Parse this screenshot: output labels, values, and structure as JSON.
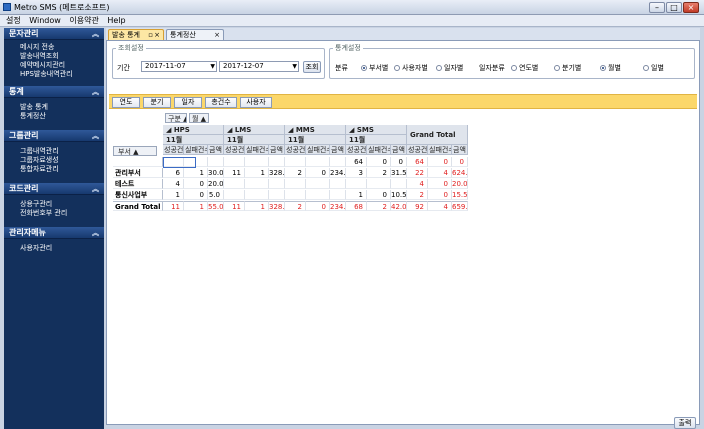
{
  "window": {
    "title": "Metro SMS (메트로소프트)"
  },
  "menu": [
    "설정",
    "Window",
    "이용약관",
    "Help"
  ],
  "sidebar": {
    "sections": [
      {
        "title": "문자관리",
        "items": [
          "메시지 전송",
          "발송내역조회",
          "예약메시지관리",
          "HPS발송내역관리"
        ]
      },
      {
        "title": "통계",
        "items": [
          "발송 통계",
          "통계정산"
        ]
      },
      {
        "title": "그룹관리",
        "items": [
          "그룹내역관리",
          "그룹자료생성",
          "통합자료관리"
        ]
      },
      {
        "title": "코드관리",
        "items": [
          "상용구관리",
          "전화번호부 관리"
        ]
      },
      {
        "title": "관리자메뉴",
        "items": [
          "사용자관리"
        ]
      }
    ]
  },
  "tabs": [
    {
      "label": "발송 통계",
      "pin": "▫",
      "close": "×"
    },
    {
      "label": "통계정산",
      "close": "×"
    }
  ],
  "filter": {
    "legend_left": "조회설정",
    "legend_right": "통계설정",
    "period_label": "기간",
    "date_from": "2017-11-07",
    "date_to": "2017-12-07",
    "search_btn": "조회",
    "category_label": "분류",
    "category_options": [
      "부서별",
      "사용자별",
      "일자별"
    ],
    "date_cat_label": "일자분류",
    "date_cat_options": [
      "연도별",
      "분기별",
      "월별",
      "일별"
    ],
    "selected_category": "부서별",
    "selected_date_cat": "월별"
  },
  "field_buttons": [
    "연도",
    "분기",
    "일자",
    "총건수",
    "사용자"
  ],
  "pivot": {
    "col_area": [
      "구분 ▲",
      "월 ▲"
    ],
    "row_area": "부서 ▲",
    "groups": [
      {
        "name": "HPS",
        "month": "11월"
      },
      {
        "name": "LMS",
        "month": "11월"
      },
      {
        "name": "MMS",
        "month": "11월"
      },
      {
        "name": "SMS",
        "month": "11월"
      }
    ],
    "grand_total": "Grand Total",
    "sub_headers": [
      "성공건수",
      "실패건수",
      "금액"
    ],
    "rows": [
      {
        "label": "",
        "cells": [
          "",
          "",
          "",
          "",
          "",
          "",
          "",
          "",
          "",
          "64",
          "0",
          "0",
          "64",
          "0",
          "0"
        ]
      },
      {
        "label": "관리부서",
        "cells": [
          "6",
          "1",
          "30.0",
          "11",
          "1",
          "328.9",
          "2",
          "0",
          "234.0",
          "3",
          "2",
          "31.5",
          "22",
          "4",
          "624.4"
        ]
      },
      {
        "label": "테스트",
        "cells": [
          "4",
          "0",
          "20.0",
          "",
          "",
          "",
          "",
          "",
          "",
          "",
          "",
          "",
          "4",
          "0",
          "20.0"
        ]
      },
      {
        "label": "통신사업부",
        "cells": [
          "1",
          "0",
          "5.0",
          "",
          "",
          "",
          "",
          "",
          "",
          "1",
          "0",
          "10.5",
          "2",
          "0",
          "15.5"
        ]
      },
      {
        "label": "Grand Total",
        "cells": [
          "11",
          "1",
          "55.0",
          "11",
          "1",
          "328.9",
          "2",
          "0",
          "234.0",
          "68",
          "2",
          "42.0",
          "92",
          "4",
          "659.9"
        ]
      }
    ]
  },
  "output_btn": "출력",
  "colors": {
    "sidebar": "#13305c",
    "accent": "#fbd76a",
    "total_red": "#e02020"
  }
}
